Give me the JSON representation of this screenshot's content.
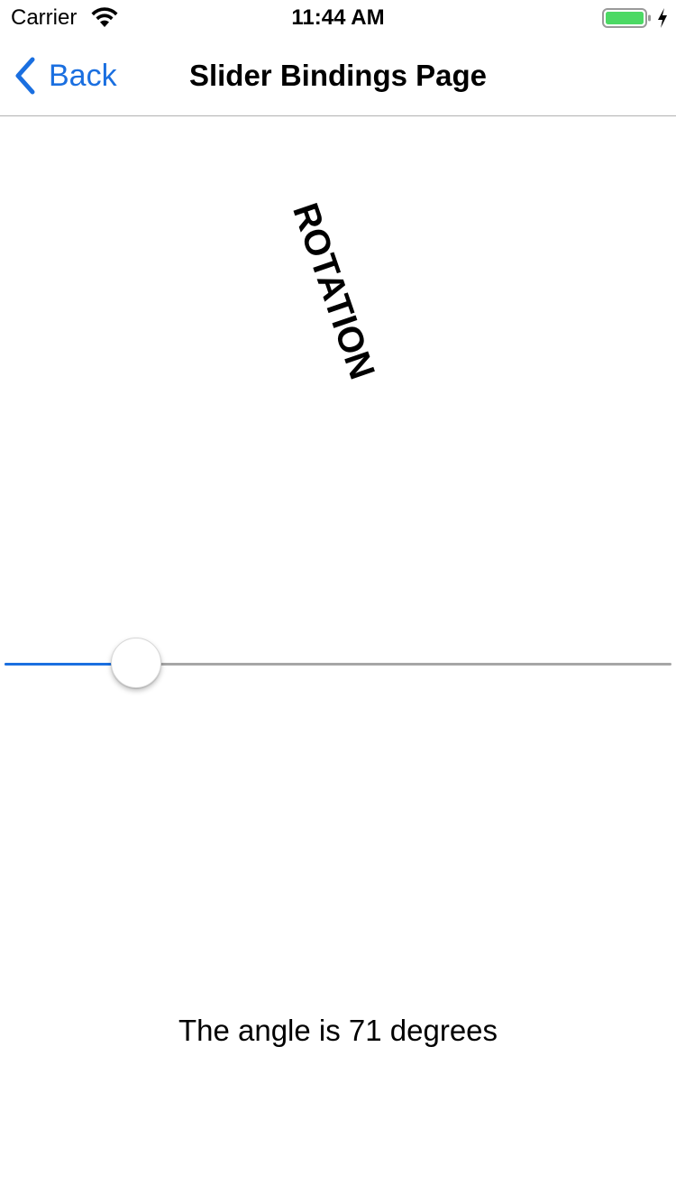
{
  "status_bar": {
    "carrier": "Carrier",
    "time": "11:44 AM",
    "icons": [
      "wifi-icon",
      "battery-icon",
      "charging-bolt-icon"
    ],
    "battery_color": "#4cd964"
  },
  "nav": {
    "back_label": "Back",
    "title": "Slider Bindings Page",
    "accent_color": "#1a6fe0"
  },
  "content": {
    "rotated_label": "ROTATION",
    "rotation_degrees": 71,
    "slider": {
      "min": 0,
      "max": 360,
      "value": 71
    },
    "angle_text": "The angle is 71 degrees"
  }
}
